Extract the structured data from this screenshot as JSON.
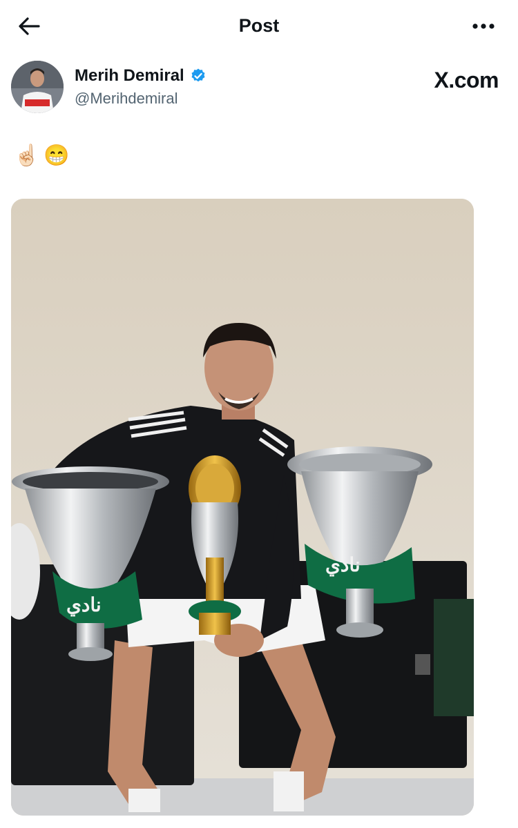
{
  "header": {
    "title": "Post"
  },
  "author": {
    "name": "Merih Demiral",
    "handle": "@Merihdemiral",
    "verified": true,
    "avatar_icon": "profile-photo"
  },
  "site_mark": "X.com",
  "post": {
    "text_emojis": [
      "☝🏻",
      "😁"
    ]
  },
  "media": {
    "description_icon": "photo-player-with-trophies"
  },
  "colors": {
    "verified_badge": "#1d9bf0",
    "handle_text": "#536471",
    "text": "#0f1419"
  }
}
